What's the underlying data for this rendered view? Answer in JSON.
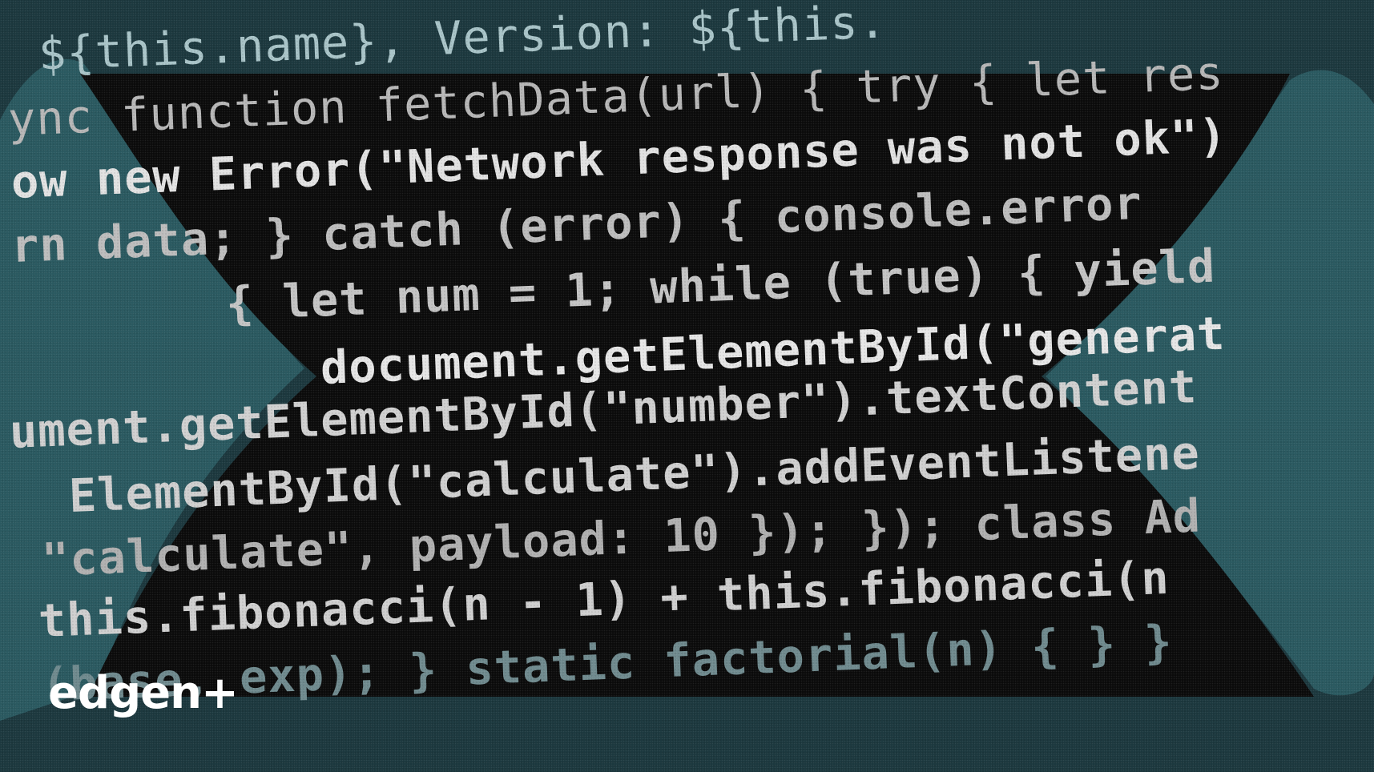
{
  "brand": {
    "logo_text": "edgen+"
  },
  "colors": {
    "teal_background": "#1d3a40",
    "teal_shape": "#2b5b63",
    "dark_panel": "#0c0c0c",
    "code_text": "#c9c9c9",
    "logo": "#ffffff"
  },
  "code_lines": [
    {
      "text": "${this.name}, Version: ${this."
    },
    {
      "text": "ync function fetchData(url) { try { let res"
    },
    {
      "text": "ow new Error(\"Network response was not ok\")"
    },
    {
      "text": "rn data; } catch (error) { console.error"
    },
    {
      "text": "{ let num = 1; while (true) { yield"
    },
    {
      "text": "document.getElementById(\"generat"
    },
    {
      "text": "ument.getElementById(\"number\").textContent"
    },
    {
      "text": "ElementById(\"calculate\").addEventListene"
    },
    {
      "text": "\"calculate\", payload: 10 }); }); class Ad"
    },
    {
      "text": "this.fibonacci(n - 1) + this.fibonacci(n"
    },
    {
      "text": "(base, exp); } static factorial(n) { } }"
    }
  ]
}
